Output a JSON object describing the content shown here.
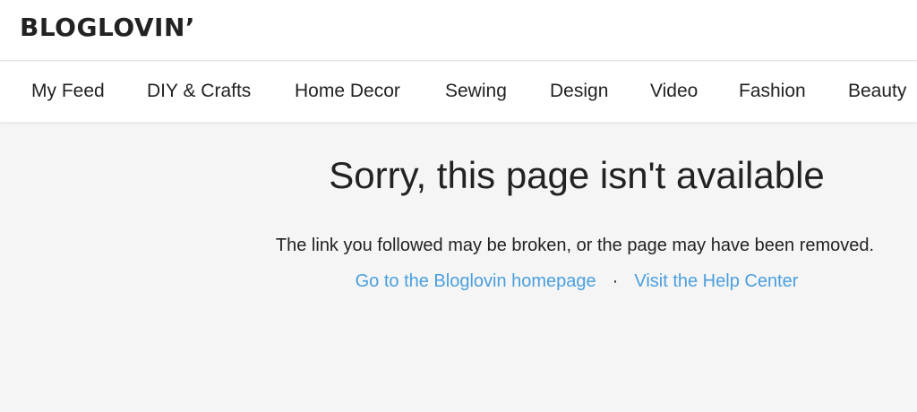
{
  "header": {
    "logo_text": "BLOGLOVIN’"
  },
  "nav": {
    "items": [
      {
        "label": "My Feed"
      },
      {
        "label": "DIY & Crafts"
      },
      {
        "label": "Home Decor"
      },
      {
        "label": "Sewing"
      },
      {
        "label": "Design"
      },
      {
        "label": "Video"
      },
      {
        "label": "Fashion"
      },
      {
        "label": "Beauty"
      }
    ]
  },
  "error": {
    "title": "Sorry, this page isn't available",
    "message": "The link you followed may be broken, or the page may have been removed.",
    "homepage_link": "Go to the Bloglovin homepage",
    "separator": "·",
    "help_link": "Visit the Help Center"
  },
  "colors": {
    "link": "#4a9fde",
    "background": "#f5f5f5",
    "text": "#222222"
  }
}
